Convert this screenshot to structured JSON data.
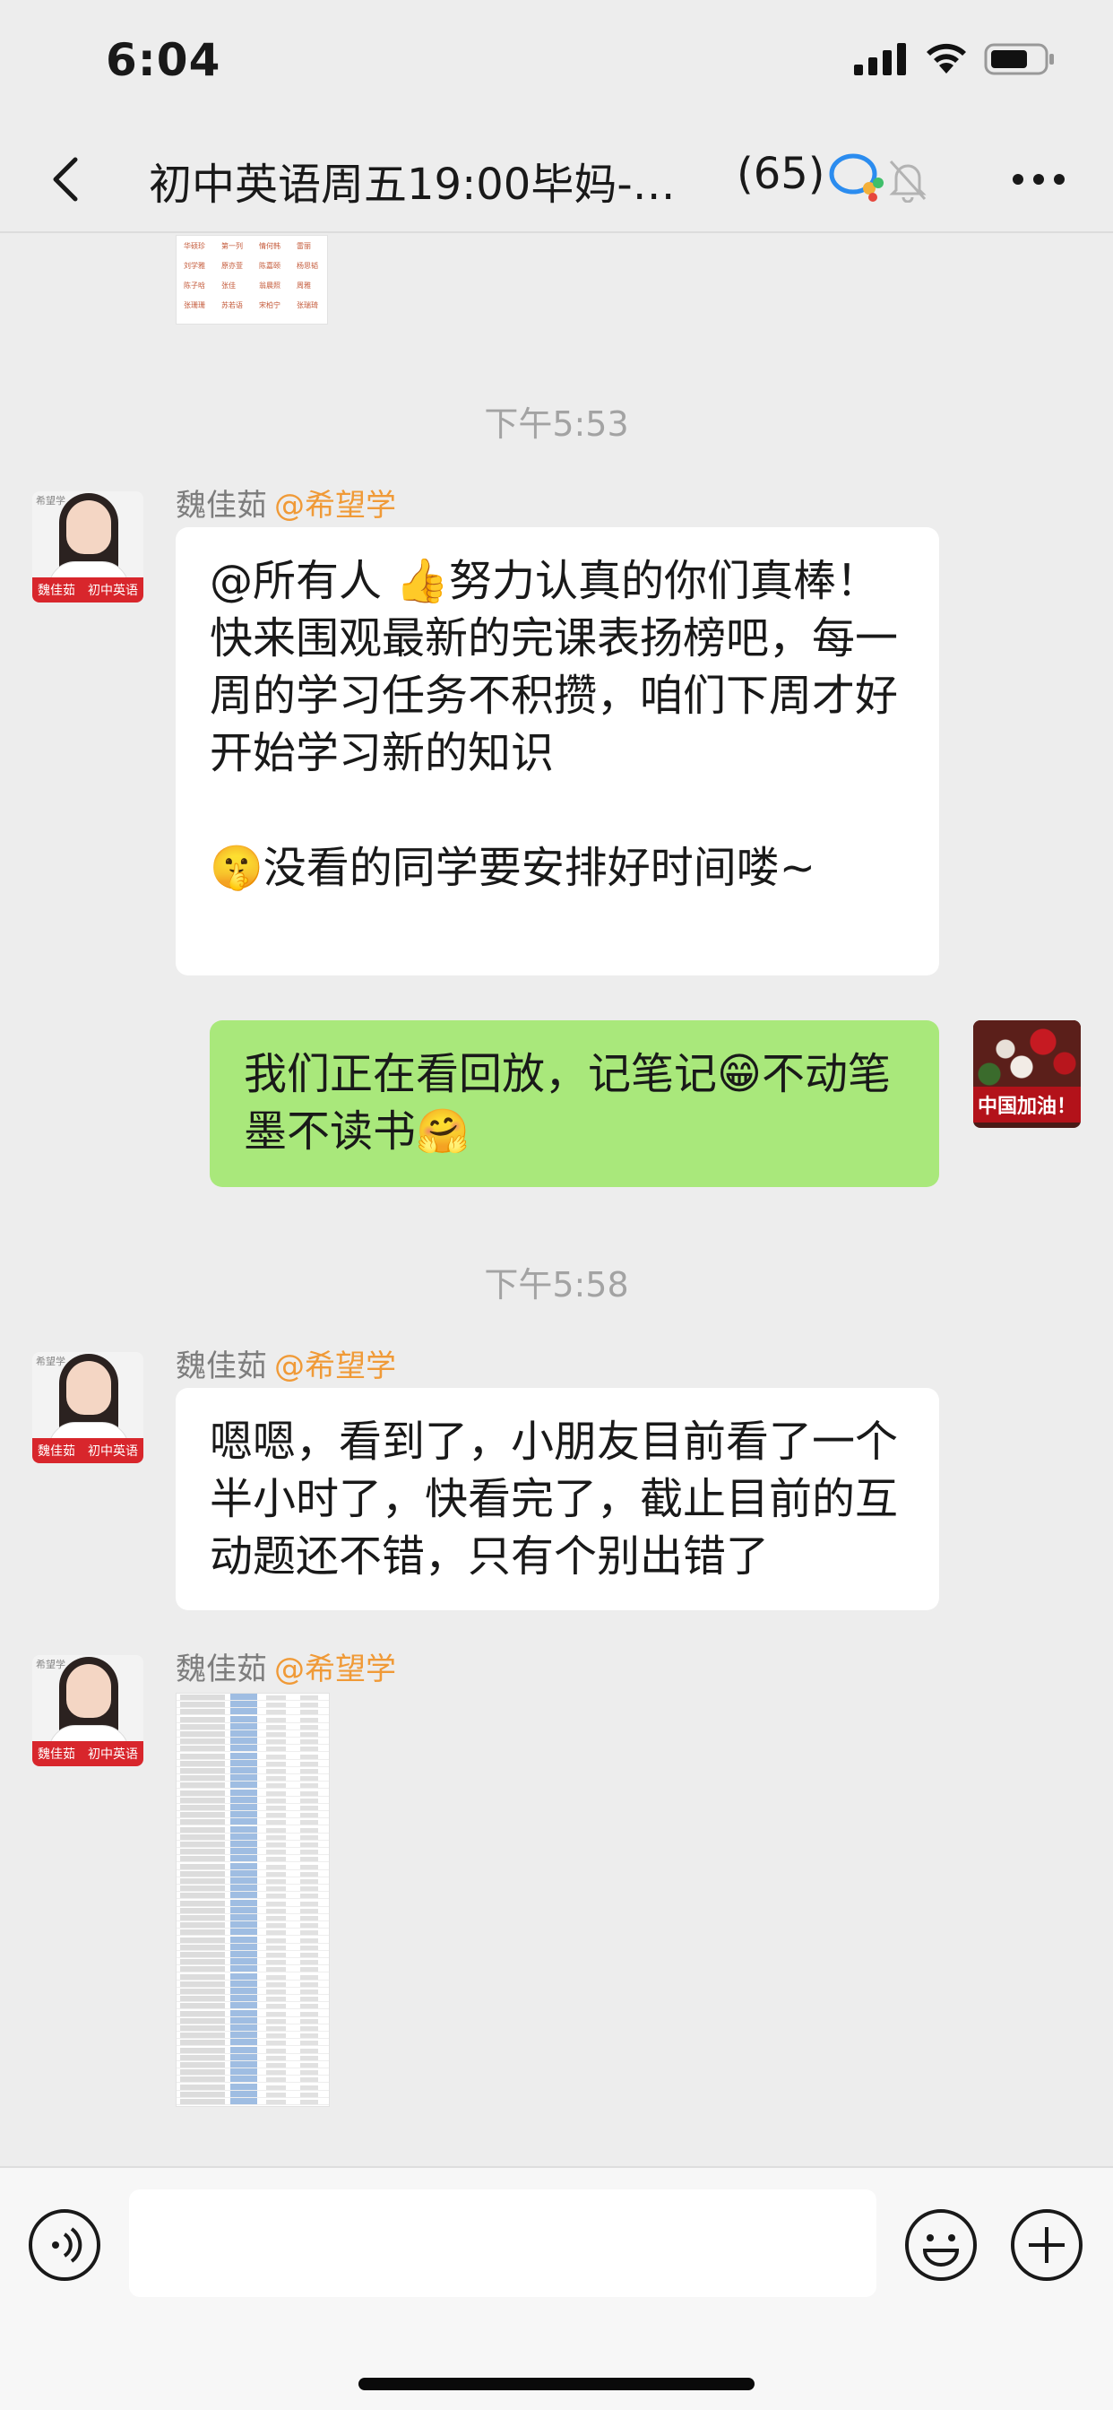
{
  "status_bar": {
    "time": "6:04"
  },
  "nav": {
    "title": "初中英语周五19:00毕妈-…",
    "member_count": "(65)"
  },
  "messages": [
    {
      "type": "time",
      "text": "下午5:53"
    },
    {
      "type": "in",
      "sender": "魏佳茹",
      "org": "@希望学",
      "text": "@所有人 👍努力认真的你们真棒！\n快来围观最新的完课表扬榜吧，每一周的学习任务不积攒，咱们下周才好开始学习新的知识\n\n🤫没看的同学要安排好时间喽~"
    },
    {
      "type": "out",
      "text": "我们正在看回放，记笔记😁不动笔墨不读书🤗"
    },
    {
      "type": "time",
      "text": "下午5:58"
    },
    {
      "type": "in",
      "sender": "魏佳茹",
      "org": "@希望学",
      "text": "嗯嗯，看到了，小朋友目前看了一个半小时了，快看完了，截止目前的互动题还不错，只有个别出错了"
    },
    {
      "type": "in-image",
      "sender": "魏佳茹",
      "org": "@希望学"
    }
  ],
  "avatar": {
    "brand": "希望学",
    "name": "魏佳茹",
    "course": "初中英语"
  },
  "my_avatar": {
    "label": "中国加油！"
  },
  "thumbnail_top": {
    "cells": [
      "华硕珍",
      "第一列",
      "情何韩",
      "雷丽",
      "刘学雅",
      "原亦萱",
      "陈嘉颐",
      "杨思韬",
      "陈子晗",
      "张佳",
      "翁晨照",
      "周雅",
      "张珊珊",
      "苏若语",
      "宋柏宁",
      "张瑞琦"
    ]
  },
  "input": {
    "placeholder": ""
  },
  "colors": {
    "accent_org": "#f09a37",
    "bubble_out": "#a9e87b",
    "bubble_in": "#ffffff",
    "background": "#ededed"
  },
  "icons": [
    "back-icon",
    "wecom-icon",
    "mute-bell-icon",
    "more-icon",
    "voice-icon",
    "emoji-icon",
    "plus-icon"
  ]
}
